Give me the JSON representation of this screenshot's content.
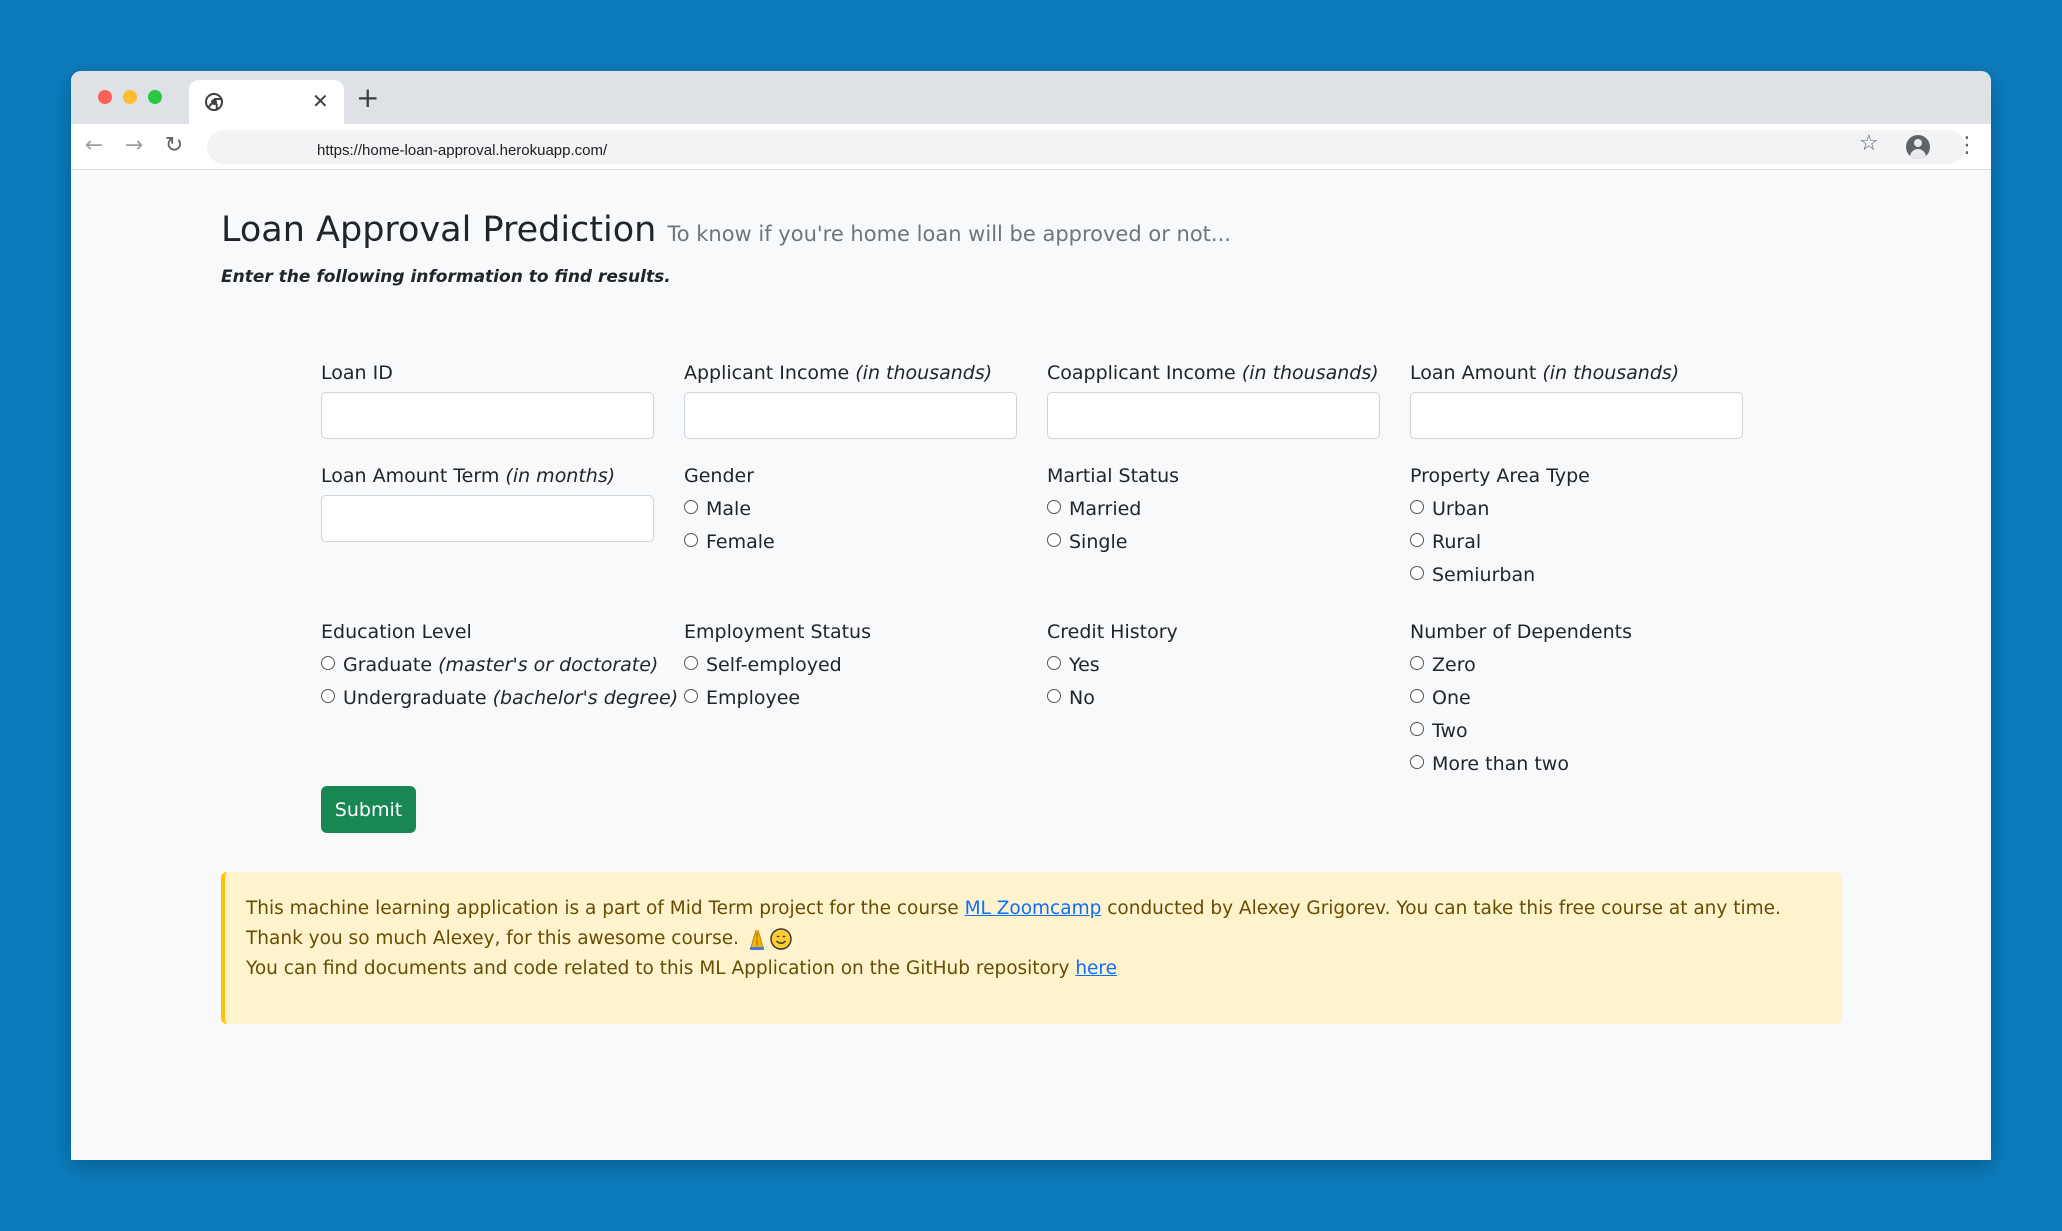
{
  "browser": {
    "url": "https://home-loan-approval.herokuapp.com/",
    "tab_close": "✕",
    "new_tab": "+"
  },
  "page": {
    "title": "Loan Approval Prediction",
    "subtitle": "To know if you're home loan will be approved or not...",
    "instruction": "Enter the following information to find results."
  },
  "fields": {
    "loan_id": {
      "label": "Loan ID",
      "value": ""
    },
    "applicant_income": {
      "label": "Applicant Income",
      "suffix": "(in thousands)",
      "value": ""
    },
    "coapplicant_income": {
      "label": "Coapplicant Income",
      "suffix": "(in thousands)",
      "value": ""
    },
    "loan_amount": {
      "label": "Loan Amount",
      "suffix": "(in thousands)",
      "value": ""
    },
    "loan_term": {
      "label": "Loan Amount Term",
      "suffix": "(in months)",
      "value": ""
    }
  },
  "radio_groups": {
    "gender": {
      "label": "Gender",
      "options": [
        "Male",
        "Female"
      ]
    },
    "marital": {
      "label": "Martial Status",
      "options": [
        "Married",
        "Single"
      ]
    },
    "property": {
      "label": "Property Area Type",
      "options": [
        "Urban",
        "Rural",
        "Semiurban"
      ]
    },
    "education": {
      "label": "Education Level",
      "options": [
        {
          "label": "Graduate",
          "note": "(master's or doctorate)"
        },
        {
          "label": "Undergraduate",
          "note": "(bachelor's degree)"
        }
      ]
    },
    "employment": {
      "label": "Employment Status",
      "options": [
        "Self-employed",
        "Employee"
      ]
    },
    "credit": {
      "label": "Credit History",
      "options": [
        "Yes",
        "No"
      ]
    },
    "dependents": {
      "label": "Number of Dependents",
      "options": [
        "Zero",
        "One",
        "Two",
        "More than two"
      ]
    }
  },
  "submit_label": "Submit",
  "alert": {
    "line1_a": "This machine learning application is a part of Mid Term project for the course ",
    "link1": "ML Zoomcamp",
    "line1_b": " conducted by Alexey Grigorev. You can take this free course at any time. Thank you so much Alexey, for this awesome course. ",
    "line2_a": "You can find documents and code related to this ML Application on the GitHub repository ",
    "link2": "here"
  }
}
